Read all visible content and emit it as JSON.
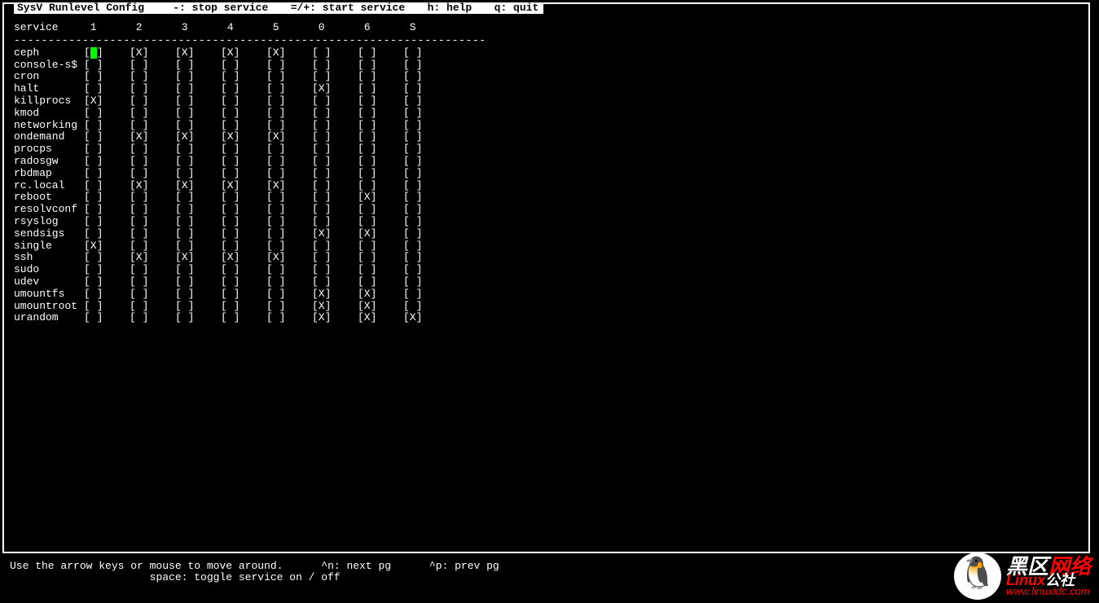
{
  "title": {
    "app": "SysV Runlevel Config",
    "hint_stop": "-: stop service",
    "hint_start": "=/+: start service",
    "hint_help": "h: help",
    "hint_quit": "q: quit"
  },
  "header": {
    "service_label": "service",
    "runlevels": [
      "1",
      "2",
      "3",
      "4",
      "5",
      "0",
      "6",
      "S"
    ]
  },
  "cursor": {
    "row": 0,
    "col": 0
  },
  "services": [
    {
      "name": "ceph",
      "levels": [
        "[X]",
        "[X]",
        "[X]",
        "[X]",
        "[X]",
        "[ ]",
        "[ ]",
        "[ ]"
      ]
    },
    {
      "name": "console-s$",
      "levels": [
        "[ ]",
        "[ ]",
        "[ ]",
        "[ ]",
        "[ ]",
        "[ ]",
        "[ ]",
        "[ ]"
      ]
    },
    {
      "name": "cron",
      "levels": [
        "[ ]",
        "[ ]",
        "[ ]",
        "[ ]",
        "[ ]",
        "[ ]",
        "[ ]",
        "[ ]"
      ]
    },
    {
      "name": "halt",
      "levels": [
        "[ ]",
        "[ ]",
        "[ ]",
        "[ ]",
        "[ ]",
        "[X]",
        "[ ]",
        "[ ]"
      ]
    },
    {
      "name": "killprocs",
      "levels": [
        "[X]",
        "[ ]",
        "[ ]",
        "[ ]",
        "[ ]",
        "[ ]",
        "[ ]",
        "[ ]"
      ]
    },
    {
      "name": "kmod",
      "levels": [
        "[ ]",
        "[ ]",
        "[ ]",
        "[ ]",
        "[ ]",
        "[ ]",
        "[ ]",
        "[ ]"
      ]
    },
    {
      "name": "networking",
      "levels": [
        "[ ]",
        "[ ]",
        "[ ]",
        "[ ]",
        "[ ]",
        "[ ]",
        "[ ]",
        "[ ]"
      ]
    },
    {
      "name": "ondemand",
      "levels": [
        "[ ]",
        "[X]",
        "[X]",
        "[X]",
        "[X]",
        "[ ]",
        "[ ]",
        "[ ]"
      ]
    },
    {
      "name": "procps",
      "levels": [
        "[ ]",
        "[ ]",
        "[ ]",
        "[ ]",
        "[ ]",
        "[ ]",
        "[ ]",
        "[ ]"
      ]
    },
    {
      "name": "radosgw",
      "levels": [
        "[ ]",
        "[ ]",
        "[ ]",
        "[ ]",
        "[ ]",
        "[ ]",
        "[ ]",
        "[ ]"
      ]
    },
    {
      "name": "rbdmap",
      "levels": [
        "[ ]",
        "[ ]",
        "[ ]",
        "[ ]",
        "[ ]",
        "[ ]",
        "[ ]",
        "[ ]"
      ]
    },
    {
      "name": "rc.local",
      "levels": [
        "[ ]",
        "[X]",
        "[X]",
        "[X]",
        "[X]",
        "[ ]",
        "[ ]",
        "[ ]"
      ]
    },
    {
      "name": "reboot",
      "levels": [
        "[ ]",
        "[ ]",
        "[ ]",
        "[ ]",
        "[ ]",
        "[ ]",
        "[X]",
        "[ ]"
      ]
    },
    {
      "name": "resolvconf",
      "levels": [
        "[ ]",
        "[ ]",
        "[ ]",
        "[ ]",
        "[ ]",
        "[ ]",
        "[ ]",
        "[ ]"
      ]
    },
    {
      "name": "rsyslog",
      "levels": [
        "[ ]",
        "[ ]",
        "[ ]",
        "[ ]",
        "[ ]",
        "[ ]",
        "[ ]",
        "[ ]"
      ]
    },
    {
      "name": "sendsigs",
      "levels": [
        "[ ]",
        "[ ]",
        "[ ]",
        "[ ]",
        "[ ]",
        "[X]",
        "[X]",
        "[ ]"
      ]
    },
    {
      "name": "single",
      "levels": [
        "[X]",
        "[ ]",
        "[ ]",
        "[ ]",
        "[ ]",
        "[ ]",
        "[ ]",
        "[ ]"
      ]
    },
    {
      "name": "ssh",
      "levels": [
        "[ ]",
        "[X]",
        "[X]",
        "[X]",
        "[X]",
        "[ ]",
        "[ ]",
        "[ ]"
      ]
    },
    {
      "name": "sudo",
      "levels": [
        "[ ]",
        "[ ]",
        "[ ]",
        "[ ]",
        "[ ]",
        "[ ]",
        "[ ]",
        "[ ]"
      ]
    },
    {
      "name": "udev",
      "levels": [
        "[ ]",
        "[ ]",
        "[ ]",
        "[ ]",
        "[ ]",
        "[ ]",
        "[ ]",
        "[ ]"
      ]
    },
    {
      "name": "umountfs",
      "levels": [
        "[ ]",
        "[ ]",
        "[ ]",
        "[ ]",
        "[ ]",
        "[X]",
        "[X]",
        "[ ]"
      ]
    },
    {
      "name": "umountroot",
      "levels": [
        "[ ]",
        "[ ]",
        "[ ]",
        "[ ]",
        "[ ]",
        "[X]",
        "[X]",
        "[ ]"
      ]
    },
    {
      "name": "urandom",
      "levels": [
        "[ ]",
        "[ ]",
        "[ ]",
        "[ ]",
        "[ ]",
        "[X]",
        "[X]",
        "[X]"
      ]
    }
  ],
  "footer": {
    "line1_left": "Use the arrow keys or mouse to move around.",
    "line1_next": "^n: next pg",
    "line1_prev": "^p: prev pg",
    "line2": "space: toggle service on / off"
  },
  "watermark": {
    "brand_a": "黑区",
    "brand_b": "网络",
    "sub_a": "Linux",
    "sub_b": "公社",
    "url": "www.linuxidc.com"
  }
}
